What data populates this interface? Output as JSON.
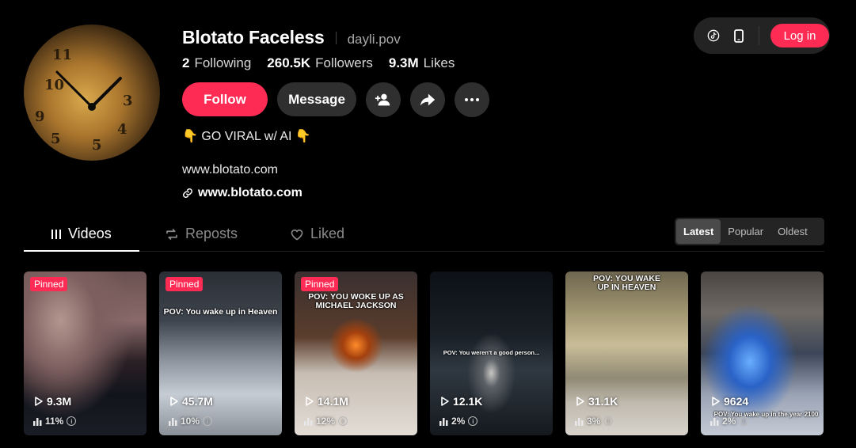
{
  "profile": {
    "name": "Blotato Faceless",
    "handle": "dayli.pov",
    "stats": {
      "following_count": "2",
      "following_label": "Following",
      "followers_count": "260.5K",
      "followers_label": "Followers",
      "likes_count": "9.3M",
      "likes_label": "Likes"
    },
    "bio": "👇 GO VIRAL w/ AI 👇",
    "bio_url": "www.blotato.com",
    "link": "www.blotato.com"
  },
  "actions": {
    "follow_label": "Follow",
    "message_label": "Message"
  },
  "topbar": {
    "login_label": "Log in"
  },
  "tabs": [
    {
      "label": "Videos",
      "active": true,
      "icon": "videos-grid-icon"
    },
    {
      "label": "Reposts",
      "active": false,
      "icon": "repost-icon"
    },
    {
      "label": "Liked",
      "active": false,
      "icon": "heart-outline-icon"
    }
  ],
  "sort": {
    "options": [
      "Latest",
      "Popular",
      "Oldest"
    ],
    "selected": "Latest"
  },
  "colors": {
    "accent": "#fe2c55",
    "background": "#000000",
    "surface": "#2f2f2f"
  },
  "videos": [
    {
      "pinned": true,
      "pinned_label": "Pinned",
      "views": "9.3M",
      "percent": "11%",
      "overlay": ""
    },
    {
      "pinned": true,
      "pinned_label": "Pinned",
      "views": "45.7M",
      "percent": "10%",
      "overlay": "POV: You wake up in Heaven"
    },
    {
      "pinned": true,
      "pinned_label": "Pinned",
      "views": "14.1M",
      "percent": "12%",
      "overlay": "POV: YOU WOKE UP AS MICHAEL JACKSON"
    },
    {
      "pinned": false,
      "views": "12.1K",
      "percent": "2%",
      "overlay": "POV: You weren't a good person..."
    },
    {
      "pinned": false,
      "views": "31.1K",
      "percent": "3%",
      "overlay": "POV: YOU WAKE UP IN HEAVEN"
    },
    {
      "pinned": false,
      "views": "9624",
      "percent": "2%",
      "overlay": "POV: You wake up in the year 2100"
    }
  ]
}
